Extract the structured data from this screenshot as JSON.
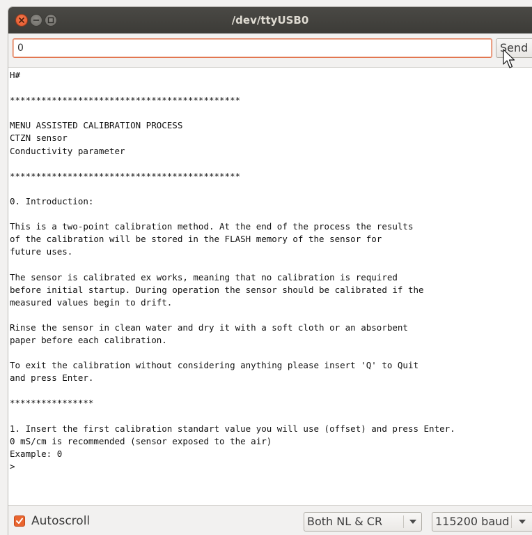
{
  "window": {
    "title": "/dev/ttyUSB0"
  },
  "input": {
    "value": "0",
    "send_label": "Send"
  },
  "console": {
    "lines": [
      "H#",
      "",
      "********************************************",
      "",
      "MENU ASSISTED CALIBRATION PROCESS",
      "CTZN sensor",
      "Conductivity parameter",
      "",
      "********************************************",
      "",
      "0. Introduction:",
      "",
      "This is a two-point calibration method. At the end of the process the results",
      "of the calibration will be stored in the FLASH memory of the sensor for",
      "future uses.",
      "",
      "The sensor is calibrated ex works, meaning that no calibration is required",
      "before initial startup. During operation the sensor should be calibrated if the",
      "measured values begin to drift.",
      "",
      "Rinse the sensor in clean water and dry it with a soft cloth or an absorbent",
      "paper before each calibration.",
      "",
      "To exit the calibration without considering anything please insert 'Q' to Quit",
      "and press Enter.",
      "",
      "****************",
      "",
      "1. Insert the first calibration standart value you will use (offset) and press Enter.",
      "0 mS/cm is recommended (sensor exposed to the air)",
      "Example: 0",
      ">"
    ]
  },
  "status": {
    "autoscroll_label": "Autoscroll",
    "autoscroll_checked": true,
    "line_ending": "Both NL & CR",
    "baud_rate": "115200 baud"
  },
  "colors": {
    "accent": "#e9652f",
    "titlebar": "#3c3b37"
  }
}
